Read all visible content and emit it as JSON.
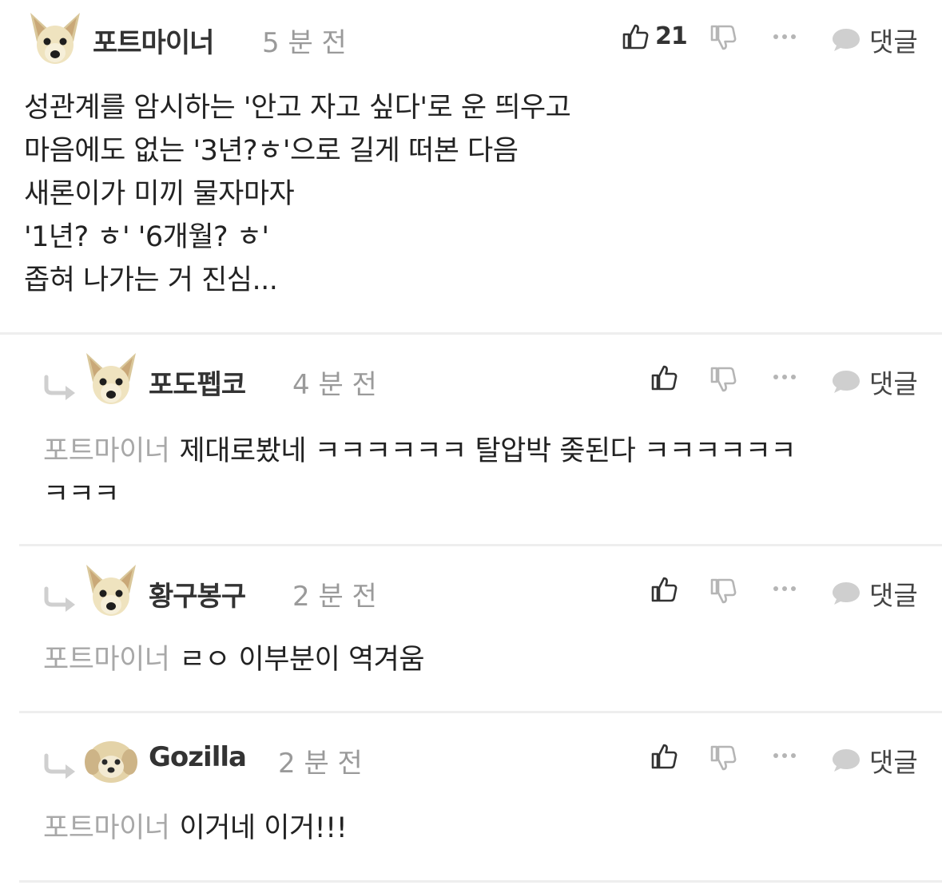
{
  "main_comment": {
    "username": "포트마이너",
    "time": "5 분 전",
    "likes": "21",
    "reply_label": "댓글",
    "lines": [
      "성관계를 암시하는 '안고 자고 싶다'로 운 띄우고",
      "마음에도 없는 '3년?ㅎ'으로 길게 떠본 다음",
      "새론이가 미끼 물자마자",
      "'1년? ㅎ' '6개월? ㅎ'",
      "좁혀 나가는 거 진심..."
    ]
  },
  "replies": [
    {
      "username": "포도펩코",
      "time": "4 분 전",
      "reply_label": "댓글",
      "mention": "포트마이너",
      "text_line1": "제대로봤네 ㅋㅋㅋㅋㅋㅋ 탈압박 좆된다 ㅋㅋㅋㅋㅋㅋ",
      "text_line2": "ㅋㅋㅋ"
    },
    {
      "username": "황구봉구",
      "time": "2 분 전",
      "reply_label": "댓글",
      "mention": "포트마이너",
      "text_line1": "ㄹㅇ 이부분이 역겨움"
    },
    {
      "username": "Gozilla",
      "time": "2 분 전",
      "reply_label": "댓글",
      "mention": "포트마이너",
      "text_line1": "이거네 이거!!!"
    }
  ],
  "icons": {
    "like": "thumbs-up-icon",
    "dislike": "thumbs-down-icon",
    "more": "more-dots-icon",
    "reply": "speech-bubble-icon",
    "reply_arrow": "reply-arrow-icon",
    "avatar_dog": "dog-avatar-icon",
    "avatar_puppy": "puppy-avatar-icon"
  },
  "colors": {
    "text": "#222222",
    "username": "#333333",
    "timestamp": "#9a9a9a",
    "mention": "#a8a8a8",
    "icon": "#333333",
    "icon_muted": "#b0b0b0",
    "divider": "#eeeeee"
  }
}
